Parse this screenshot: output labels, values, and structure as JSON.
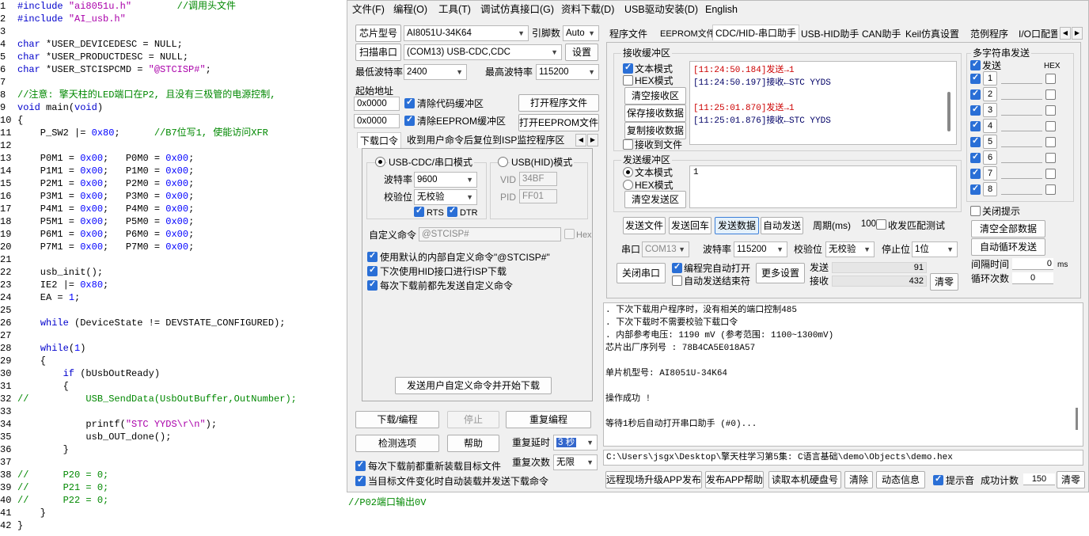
{
  "editor": {
    "lines": [
      {
        "n": "1",
        "segs": [
          [
            "kw",
            "#include "
          ],
          [
            "st",
            "\"ai8051u.h\""
          ],
          [
            "cd",
            "        "
          ],
          [
            "cm",
            "//调用头文件"
          ]
        ]
      },
      {
        "n": "2",
        "segs": [
          [
            "kw",
            "#include "
          ],
          [
            "st",
            "\"AI_usb.h\""
          ]
        ]
      },
      {
        "n": "3",
        "segs": []
      },
      {
        "n": "4",
        "segs": [
          [
            "kw",
            "char"
          ],
          [
            "cd",
            " *USER_DEVICEDESC = NULL;"
          ]
        ]
      },
      {
        "n": "5",
        "segs": [
          [
            "kw",
            "char"
          ],
          [
            "cd",
            " *USER_PRODUCTDESC = NULL;"
          ]
        ]
      },
      {
        "n": "6",
        "segs": [
          [
            "kw",
            "char"
          ],
          [
            "cd",
            " *USER_STCISPCMD = "
          ],
          [
            "st",
            "\"@STCISP#\""
          ],
          [
            "cd",
            ";"
          ]
        ]
      },
      {
        "n": "7",
        "segs": []
      },
      {
        "n": "8",
        "segs": [
          [
            "cm",
            "//注意: 擎天柱的LED端口在P2, 且没有三极管的电源控制,"
          ]
        ]
      },
      {
        "n": "9",
        "segs": [
          [
            "kw",
            "void"
          ],
          [
            "cd",
            " main("
          ],
          [
            "kw",
            "void"
          ],
          [
            "cd",
            ")"
          ]
        ]
      },
      {
        "n": "10",
        "segs": [
          [
            "cd",
            "{"
          ]
        ]
      },
      {
        "n": "11",
        "segs": [
          [
            "cd",
            "    P_SW2 |= "
          ],
          [
            "nm",
            "0x80"
          ],
          [
            "cd",
            ";      "
          ],
          [
            "cm",
            "//B7位写1, 使能访问XFR"
          ]
        ]
      },
      {
        "n": "12",
        "segs": []
      },
      {
        "n": "13",
        "segs": [
          [
            "cd",
            "    P0M1 = "
          ],
          [
            "nm",
            "0x00"
          ],
          [
            "cd",
            ";   P0M0 = "
          ],
          [
            "nm",
            "0x00"
          ],
          [
            "cd",
            ";"
          ]
        ]
      },
      {
        "n": "14",
        "segs": [
          [
            "cd",
            "    P1M1 = "
          ],
          [
            "nm",
            "0x00"
          ],
          [
            "cd",
            ";   P1M0 = "
          ],
          [
            "nm",
            "0x00"
          ],
          [
            "cd",
            ";"
          ]
        ]
      },
      {
        "n": "15",
        "segs": [
          [
            "cd",
            "    P2M1 = "
          ],
          [
            "nm",
            "0x00"
          ],
          [
            "cd",
            ";   P2M0 = "
          ],
          [
            "nm",
            "0x00"
          ],
          [
            "cd",
            ";"
          ]
        ]
      },
      {
        "n": "16",
        "segs": [
          [
            "cd",
            "    P3M1 = "
          ],
          [
            "nm",
            "0x00"
          ],
          [
            "cd",
            ";   P3M0 = "
          ],
          [
            "nm",
            "0x00"
          ],
          [
            "cd",
            ";"
          ]
        ]
      },
      {
        "n": "17",
        "segs": [
          [
            "cd",
            "    P4M1 = "
          ],
          [
            "nm",
            "0x00"
          ],
          [
            "cd",
            ";   P4M0 = "
          ],
          [
            "nm",
            "0x00"
          ],
          [
            "cd",
            ";"
          ]
        ]
      },
      {
        "n": "18",
        "segs": [
          [
            "cd",
            "    P5M1 = "
          ],
          [
            "nm",
            "0x00"
          ],
          [
            "cd",
            ";   P5M0 = "
          ],
          [
            "nm",
            "0x00"
          ],
          [
            "cd",
            ";"
          ]
        ]
      },
      {
        "n": "19",
        "segs": [
          [
            "cd",
            "    P6M1 = "
          ],
          [
            "nm",
            "0x00"
          ],
          [
            "cd",
            ";   P6M0 = "
          ],
          [
            "nm",
            "0x00"
          ],
          [
            "cd",
            ";"
          ]
        ]
      },
      {
        "n": "20",
        "segs": [
          [
            "cd",
            "    P7M1 = "
          ],
          [
            "nm",
            "0x00"
          ],
          [
            "cd",
            ";   P7M0 = "
          ],
          [
            "nm",
            "0x00"
          ],
          [
            "cd",
            ";"
          ]
        ]
      },
      {
        "n": "21",
        "segs": []
      },
      {
        "n": "22",
        "segs": [
          [
            "cd",
            "    usb_init();"
          ]
        ]
      },
      {
        "n": "23",
        "segs": [
          [
            "cd",
            "    IE2 |= "
          ],
          [
            "nm",
            "0x80"
          ],
          [
            "cd",
            ";"
          ]
        ]
      },
      {
        "n": "24",
        "segs": [
          [
            "cd",
            "    EA = "
          ],
          [
            "nm",
            "1"
          ],
          [
            "cd",
            ";"
          ]
        ]
      },
      {
        "n": "25",
        "segs": []
      },
      {
        "n": "26",
        "segs": [
          [
            "cd",
            "    "
          ],
          [
            "kw",
            "while"
          ],
          [
            "cd",
            " (DeviceState != DEVSTATE_CONFIGURED);"
          ]
        ]
      },
      {
        "n": "27",
        "segs": []
      },
      {
        "n": "28",
        "segs": [
          [
            "cd",
            "    "
          ],
          [
            "kw",
            "while"
          ],
          [
            "cd",
            "("
          ],
          [
            "nm",
            "1"
          ],
          [
            "cd",
            ")"
          ]
        ]
      },
      {
        "n": "29",
        "segs": [
          [
            "cd",
            "    {"
          ]
        ]
      },
      {
        "n": "30",
        "segs": [
          [
            "cd",
            "        "
          ],
          [
            "kw",
            "if"
          ],
          [
            "cd",
            " (bUsbOutReady)"
          ]
        ]
      },
      {
        "n": "31",
        "segs": [
          [
            "cd",
            "        {"
          ]
        ]
      },
      {
        "n": "32",
        "segs": [
          [
            "cm",
            "//          USB_SendData(UsbOutBuffer,OutNumber);"
          ]
        ]
      },
      {
        "n": "33",
        "segs": []
      },
      {
        "n": "34",
        "segs": [
          [
            "cd",
            "            printf("
          ],
          [
            "st",
            "\"STC YYDS\\r\\n\""
          ],
          [
            "cd",
            ");"
          ]
        ]
      },
      {
        "n": "35",
        "segs": [
          [
            "cd",
            "            usb_OUT_done();"
          ]
        ]
      },
      {
        "n": "36",
        "segs": [
          [
            "cd",
            "        }"
          ]
        ]
      },
      {
        "n": "37",
        "segs": []
      },
      {
        "n": "38",
        "segs": [
          [
            "cm",
            "//      P20 = 0;"
          ]
        ]
      },
      {
        "n": "39",
        "segs": [
          [
            "cm",
            "//      P21 = 0;"
          ]
        ]
      },
      {
        "n": "40",
        "segs": [
          [
            "cm",
            "//      P22 = 0;"
          ]
        ]
      },
      {
        "n": "41",
        "segs": [
          [
            "cd",
            "    }"
          ]
        ]
      },
      {
        "n": "42",
        "segs": [
          [
            "cd",
            "}"
          ]
        ]
      }
    ],
    "tail_comment": "//P02端口输出0V"
  },
  "menu": [
    "文件(F)",
    "编程(O)",
    "工具(T)",
    "调试仿真接口(G)",
    "资料下载(D)",
    "USB驱动安装(D)",
    "English"
  ],
  "left": {
    "chip_label": "芯片型号",
    "chip_value": "AI8051U-34K64",
    "ref_freq_label": "引脚数",
    "ref_freq_value": "Auto",
    "scan_btn": "扫描串口",
    "port_value": "(COM13) USB-CDC,CDC",
    "settings_btn": "设置",
    "min_baud_label": "最低波特率",
    "min_baud_value": "2400",
    "max_baud_label": "最高波特率",
    "max_baud_value": "115200",
    "start_addr_label": "起始地址",
    "addr1": "0x0000",
    "clear_code_label": "清除代码缓冲区",
    "open_prog_btn": "打开程序文件",
    "addr2": "0x0000",
    "clear_eeprom_label": "清除EEPROM缓冲区",
    "open_eeprom_btn": "打开EEPROM文件",
    "tabs": [
      "下载口令",
      "收到用户命令后复位到ISP监控程序区"
    ],
    "usb_cdc_mode": "USB-CDC/串口模式",
    "usb_hid_mode": "USB(HID)模式",
    "baud_label": "波特率",
    "baud_value": "9600",
    "parity_label": "校验位",
    "parity_value": "无校验",
    "rts": "RTS",
    "dtr": "DTR",
    "vid_label": "VID",
    "vid_value": "34BF",
    "pid_label": "PID",
    "pid_value": "FF01",
    "custom_cmd_label": "自定义命令",
    "custom_cmd_value": "@STCISP#",
    "hex_label": "Hex",
    "opt1": "使用默认的内部自定义命令\"@STCISP#\"",
    "opt2": "下次使用HID接口进行ISP下载",
    "opt3": "每次下载前都先发送自定义命令",
    "send_custom_btn": "发送用户自定义命令并开始下载",
    "download_btn": "下载/编程",
    "stop_btn": "停止",
    "reprogram_btn": "重复编程",
    "check_btn": "检测选项",
    "help_btn": "帮助",
    "repeat_delay_label": "重复延时",
    "repeat_delay_value": "3 秒",
    "repeat_count_label": "重复次数",
    "repeat_count_value": "无限",
    "reload_label": "每次下载前都重新装载目标文件",
    "autosend_label": "当目标文件变化时自动装载并发送下载命令"
  },
  "right": {
    "tabs": [
      "程序文件",
      "EEPROM文件",
      "CDC/HID-串口助手",
      "USB-HID助手",
      "CAN助手",
      "Keil仿真设置",
      "范例程序",
      "I/O口配置"
    ],
    "recv_group": "接收缓冲区",
    "text_mode": "文本模式",
    "hex_mode": "HEX模式",
    "clear_recv_btn": "清空接收区",
    "save_recv_btn": "保存接收数据",
    "copy_recv_btn": "复制接收数据",
    "recv_to_file": "接收到文件",
    "recv_log": [
      {
        "ts": "[11:24:50.184]",
        "msg": "发送→1",
        "kind": "send"
      },
      {
        "ts": "[11:24:50.197]",
        "msg": "接收←STC YYDS",
        "kind": "recv"
      },
      {
        "ts": "",
        "msg": "",
        "kind": "blank"
      },
      {
        "ts": "[11:25:01.870]",
        "msg": "发送→1",
        "kind": "send"
      },
      {
        "ts": "[11:25:01.876]",
        "msg": "接收←STC YYDS",
        "kind": "recv"
      }
    ],
    "send_group": "发送缓冲区",
    "send_text_mode": "文本模式",
    "send_hex_mode": "HEX模式",
    "clear_send_btn": "清空发送区",
    "send_content": "1",
    "send_file_btn": "发送文件",
    "send_enter_btn": "发送回车",
    "send_data_btn": "发送数据",
    "auto_send_btn": "自动发送",
    "period_label": "周期(ms)",
    "period_value": "100",
    "match_test": "收发匹配测试",
    "port_label": "串口",
    "port_value": "COM13",
    "baud_label": "波特率",
    "baud_value": "115200",
    "parity_label": "校验位",
    "parity_value": "无校验",
    "stop_label": "停止位",
    "stop_value": "1位",
    "close_port_btn": "关闭串口",
    "auto_open": "编程完自动打开",
    "auto_send_end": "自动发送结束符",
    "more_btn": "更多设置",
    "sent_label": "发送",
    "sent_value": "91",
    "recv_label": "接收",
    "recv_value": "432",
    "clear_count_btn": "清零",
    "multi_title": "多字符串发送",
    "multi_send": "发送",
    "multi_hex": "HEX",
    "multi_rows": [
      "1",
      "2",
      "3",
      "4",
      "5",
      "6",
      "7",
      "8"
    ],
    "close_tips": "关闭提示",
    "clear_all_btn": "清空全部数据",
    "auto_loop_btn": "自动循环发送",
    "interval_label": "间隔时间",
    "interval_value": "0",
    "interval_unit": "ms",
    "loop_count_label": "循环次数",
    "loop_count_value": "0",
    "output_lines": [
      "  . 下次下载用户程序时，没有相关的端口控制485",
      "  . 下次下载时不需要校验下载口令",
      "  . 内部参考电压: 1190 mV (参考范围: 1100~1300mV)",
      "芯片出厂序列号 : 78B4CA5E018A57",
      "",
      "  单片机型号: AI8051U-34K64",
      "",
      "操作成功 !",
      "",
      "等待1秒后自动打开串口助手 (#0)..."
    ],
    "path": "C:\\Users\\jsgx\\Desktop\\擎天柱学习第5集: C语言基础\\demo\\Objects\\demo.hex",
    "remote_btn": "远程现场升级APP发布",
    "publish_help_btn": "发布APP帮助",
    "read_disk_btn": "读取本机硬盘号",
    "clear_btn": "清除",
    "dyn_info_btn": "动态信息",
    "beep_label": "提示音",
    "success_label": "成功计数",
    "success_value": "150",
    "clear_zero_btn": "清零"
  }
}
